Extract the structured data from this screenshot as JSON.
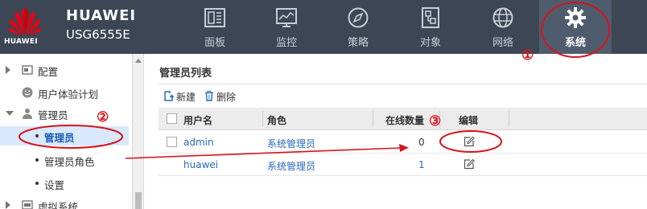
{
  "header": {
    "brand_under_logo": "HUAWEI",
    "brand_name": "HUAWEI",
    "device_model": "USG6555E",
    "nav": [
      {
        "label": "面板",
        "icon": "dashboard-icon"
      },
      {
        "label": "监控",
        "icon": "monitor-chart-icon"
      },
      {
        "label": "策略",
        "icon": "compass-icon"
      },
      {
        "label": "对象",
        "icon": "object-icon"
      },
      {
        "label": "网络",
        "icon": "globe-icon"
      },
      {
        "label": "系统",
        "icon": "gear-icon",
        "active": true
      }
    ]
  },
  "sidebar": {
    "items": [
      {
        "label": "配置",
        "icon": "config-icon",
        "expanded": false
      },
      {
        "label": "用户体验计划",
        "icon": "smiley-icon"
      },
      {
        "label": "管理员",
        "icon": "user-icon",
        "expanded": true
      },
      {
        "label": "管理员",
        "selected": true
      },
      {
        "label": "管理员角色"
      },
      {
        "label": "设置"
      },
      {
        "label": "虚拟系统",
        "icon": "virtual-system-icon",
        "expanded": false
      }
    ]
  },
  "main": {
    "title": "管理员列表",
    "toolbar": {
      "new_label": "新建",
      "delete_label": "删除"
    },
    "table": {
      "columns": [
        "用户名",
        "角色",
        "在线数量",
        "编辑"
      ],
      "rows": [
        {
          "username": "admin",
          "role": "系统管理员",
          "online": "0"
        },
        {
          "username": "huawei",
          "role": "系统管理员",
          "online": "1"
        }
      ]
    }
  },
  "annotations": {
    "marker_1": "①",
    "marker_2": "②",
    "marker_3": "③",
    "color": "#d6141c"
  },
  "colors": {
    "header_bg": "#3c4655",
    "active_nav_bg": "#4f5c6e",
    "selected_row_bg": "#d9e8fb",
    "link": "#2a6ab8"
  }
}
